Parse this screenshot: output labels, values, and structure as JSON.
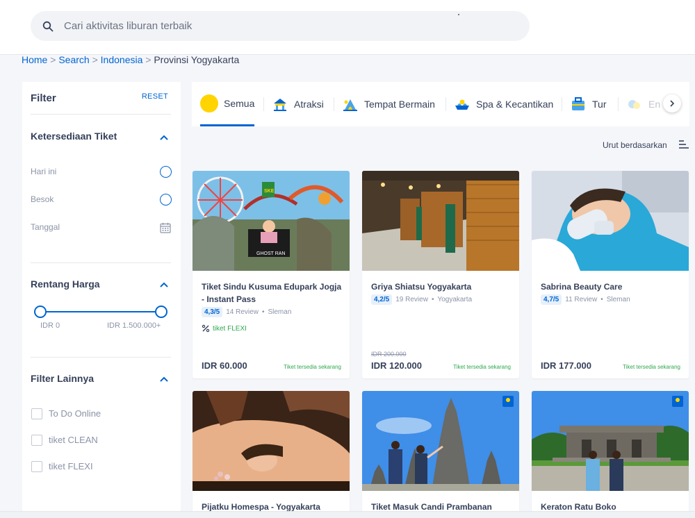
{
  "search": {
    "placeholder": "Cari aktivitas liburan terbaik"
  },
  "breadcrumb": [
    {
      "label": "Home"
    },
    {
      "label": "Search"
    },
    {
      "label": "Indonesia"
    },
    {
      "label": "Provinsi Yogyakarta"
    }
  ],
  "filter": {
    "title": "Filter",
    "reset": "RESET",
    "availability": {
      "title": "Ketersediaan Tiket",
      "options": [
        "Hari ini",
        "Besok",
        "Tanggal"
      ]
    },
    "price": {
      "title": "Rentang Harga",
      "min_label": "IDR 0",
      "max_label": "IDR 1.500.000+"
    },
    "others": {
      "title": "Filter Lainnya",
      "options": [
        "To Do Online",
        "tiket CLEAN",
        "tiket FLEXI"
      ]
    }
  },
  "tabs": [
    {
      "label": "Semua",
      "icon": "all-icon"
    },
    {
      "label": "Atraksi",
      "icon": "attraction-icon"
    },
    {
      "label": "Tempat Bermain",
      "icon": "playground-icon"
    },
    {
      "label": "Spa & Kecantikan",
      "icon": "spa-icon"
    },
    {
      "label": "Tur",
      "icon": "tour-icon"
    },
    {
      "label": "En",
      "icon": "entertainment-icon"
    }
  ],
  "sort": {
    "label": "Urut berdasarkan"
  },
  "cards": [
    {
      "name": "Tiket Sindu Kusuma Edupark Jogja - Instant Pass",
      "rating": "4,3/5",
      "reviews": "14 Review",
      "location": "Sleman",
      "flexi": "tiket FLEXI",
      "old_price": "",
      "price": "IDR 60.000",
      "availability": "Tiket tersedia sekarang"
    },
    {
      "name": "Griya Shiatsu Yogyakarta",
      "rating": "4,2/5",
      "reviews": "19 Review",
      "location": "Yogyakarta",
      "flexi": "",
      "old_price": "IDR 200.000",
      "price": "IDR 120.000",
      "availability": "Tiket tersedia sekarang"
    },
    {
      "name": "Sabrina Beauty Care",
      "rating": "4,7/5",
      "reviews": "11 Review",
      "location": "Sleman",
      "flexi": "",
      "old_price": "",
      "price": "IDR 177.000",
      "availability": "Tiket tersedia sekarang"
    },
    {
      "name": "Pijatku Homespa - Yogyakarta"
    },
    {
      "name": "Tiket Masuk Candi Prambanan"
    },
    {
      "name": "Keraton Ratu Boko"
    }
  ],
  "image_text": {
    "ghost": "GHOST RAN",
    "ske": "SKE",
    "tiket_logo": "tiket"
  },
  "colors": {
    "brand_blue": "#0064d2",
    "brand_yellow": "#ffd400",
    "available_green": "#2fa84f"
  }
}
